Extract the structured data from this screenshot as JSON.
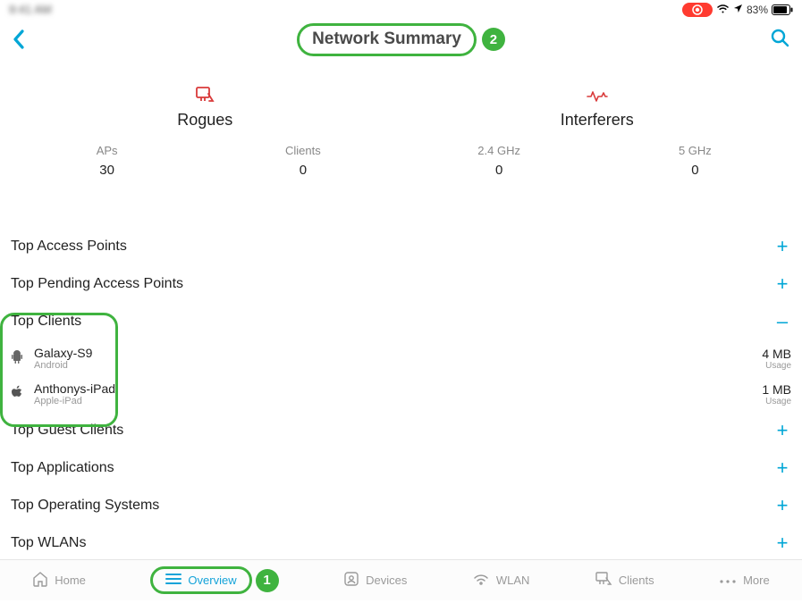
{
  "statusbar": {
    "time": "9:41 AM",
    "battery": "83%"
  },
  "header": {
    "title": "Network Summary",
    "title_badge": "2"
  },
  "tiles": [
    {
      "title": "Rogues"
    },
    {
      "title": "Interferers"
    }
  ],
  "stats": [
    {
      "label": "APs",
      "value": "30"
    },
    {
      "label": "Clients",
      "value": "0"
    },
    {
      "label": "2.4 GHz",
      "value": "0"
    },
    {
      "label": "5 GHz",
      "value": "0"
    }
  ],
  "sections": {
    "top_aps": "Top Access Points",
    "top_pending_aps": "Top Pending Access Points",
    "top_clients": "Top Clients",
    "top_guest_clients": "Top Guest Clients",
    "top_applications": "Top Applications",
    "top_os": "Top Operating Systems",
    "top_wlans": "Top WLANs"
  },
  "clients": [
    {
      "name": "Galaxy-S9",
      "sub": "Android",
      "usage": "4 MB",
      "usage_label": "Usage",
      "os": "android"
    },
    {
      "name": "Anthonys-iPad",
      "sub": "Apple-iPad",
      "usage": "1 MB",
      "usage_label": "Usage",
      "os": "apple"
    }
  ],
  "tabs": {
    "home": "Home",
    "overview": "Overview",
    "overview_badge": "1",
    "devices": "Devices",
    "wlan": "WLAN",
    "clients": "Clients",
    "more": "More"
  }
}
